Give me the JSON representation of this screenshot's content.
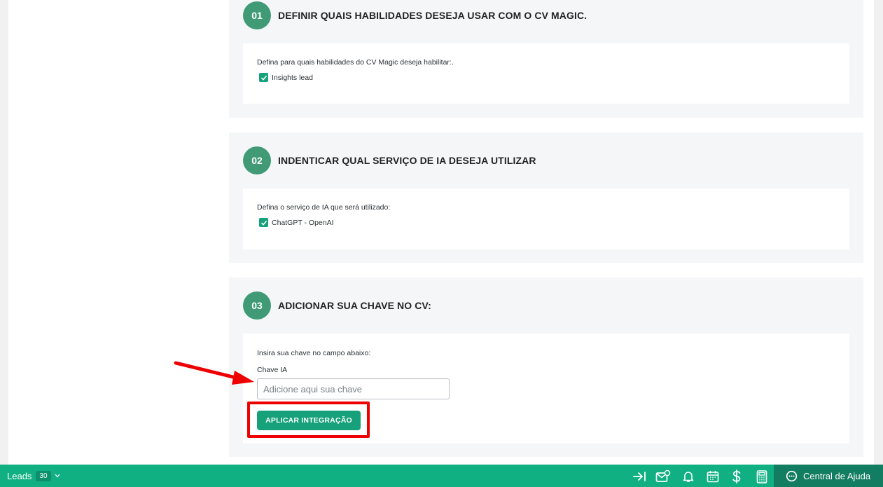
{
  "steps": [
    {
      "number": "01",
      "title": "DEFINIR QUAIS HABILIDADES DESEJA USAR COM O CV MAGIC.",
      "instruction": "Defina para quais habilidades do CV Magic deseja habilitar:.",
      "option": "Insights lead",
      "checked": true
    },
    {
      "number": "02",
      "title": "INDENTICAR QUAL SERVIÇO DE IA DESEJA UTILIZAR",
      "instruction": "Defina o serviço de IA que será utilizado:",
      "option": "ChatGPT - OpenAI",
      "checked": true
    },
    {
      "number": "03",
      "title": "ADICIONAR SUA CHAVE NO CV:",
      "instruction": "Insira sua chave no campo abaixo:",
      "field_label": "Chave IA",
      "field_value": "",
      "field_placeholder": "Adicione aqui sua chave",
      "button_label": "APLICAR INTEGRAÇÃO"
    }
  ],
  "bottombar": {
    "leads_label": "Leads",
    "leads_count": "30",
    "icons": [
      "collapse-arrow-icon",
      "mail-star-icon",
      "bell-icon",
      "calendar-icon",
      "dollar-icon",
      "calculator-icon"
    ],
    "help_label": "Central de Ajuda"
  },
  "colors": {
    "step_badge": "#3f9a75",
    "primary_button": "#17a17a",
    "bottombar": "#10b083",
    "help_panel": "#127d61",
    "annotation": "#ee0000"
  }
}
